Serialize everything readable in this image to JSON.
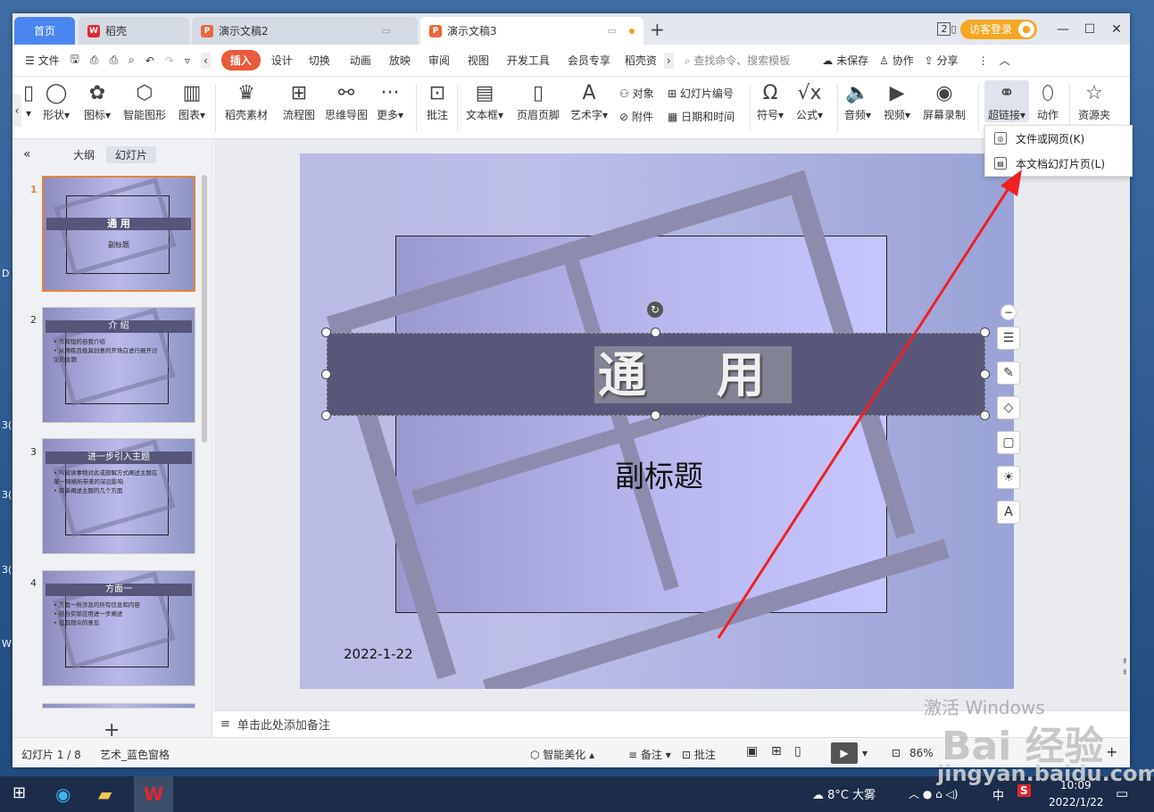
{
  "tabs": {
    "home": "首页",
    "daoke": "稻壳",
    "doc2": "演示文稿2",
    "doc3": "演示文稿3",
    "new": "+"
  },
  "window": {
    "counter": "2",
    "login": "访客登录"
  },
  "menu": {
    "file": "文件",
    "items": [
      "插入",
      "设计",
      "切换",
      "动画",
      "放映",
      "审阅",
      "视图",
      "开发工具",
      "会员专享",
      "稻壳资"
    ],
    "search": "查找命令、搜索模板",
    "unsaved": "未保存",
    "collab": "协作",
    "share": "分享"
  },
  "ribbon": {
    "shape": "形状",
    "icon": "图标",
    "smartart": "智能图形",
    "chart": "图表",
    "daoke_material": "稻壳素材",
    "flowchart": "流程图",
    "mindmap": "思维导图",
    "more": "更多",
    "comment": "批注",
    "textbox": "文本框",
    "header_footer": "页眉页脚",
    "wordart": "艺术字",
    "object": "对象",
    "slide_number": "幻灯片编号",
    "attachment": "附件",
    "datetime": "日期和时间",
    "symbol": "符号",
    "formula": "公式",
    "audio": "音频",
    "video": "视频",
    "screen_record": "屏幕录制",
    "hyperlink": "超链接",
    "action": "动作",
    "resources": "资源夹"
  },
  "dropdown": {
    "item1": "文件或网页(K)",
    "item2": "本文档幻灯片页(L)"
  },
  "pane": {
    "outline": "大纲",
    "slides": "幻灯片"
  },
  "thumbs": [
    {
      "num": "1",
      "title": "通 用",
      "sub": "副标题"
    },
    {
      "num": "2",
      "title": "介 绍",
      "bullets": [
        "• 作简短的自我介绍",
        "• 从精练且极具创意的开场白进行展开讨",
        "  论的主题"
      ]
    },
    {
      "num": "3",
      "title": "进一步引入主题",
      "bullets": [
        "• 叫阅读事物对此或部解方式阐述主题在",
        "  某一网络所带来的深远影响",
        "• 简单阐述主题的几个方面"
      ]
    },
    {
      "num": "4",
      "title": "方面一",
      "bullets": [
        "• 方面一所涉及的所有信息和内容",
        "• 结合实际应用进一步阐述",
        "• 征取观众的意见"
      ]
    }
  ],
  "slide": {
    "title": "通 用",
    "subtitle": "副标题",
    "date": "2022-1-22"
  },
  "notes": "单击此处添加备注",
  "status": {
    "slide_pos": "幻灯片 1 / 8",
    "theme": "艺术_蓝色窗格",
    "beautify": "智能美化",
    "notes_btn": "备注",
    "comment_btn": "批注",
    "zoom": "86%"
  },
  "watermark": {
    "line1": "激活 Windows",
    "line2": "Bai 经验",
    "line3": "jingyan.baidu.com"
  },
  "taskbar": {
    "weather": "8°C 大雾",
    "ime": "中",
    "time": "10:09",
    "date": "2022/1/22"
  },
  "colors": {
    "accent": "#e85a3a",
    "tab_blue": "#4a86f0",
    "title_bar": "#585779",
    "login": "#f5a623",
    "arrow": "#ee2222"
  }
}
